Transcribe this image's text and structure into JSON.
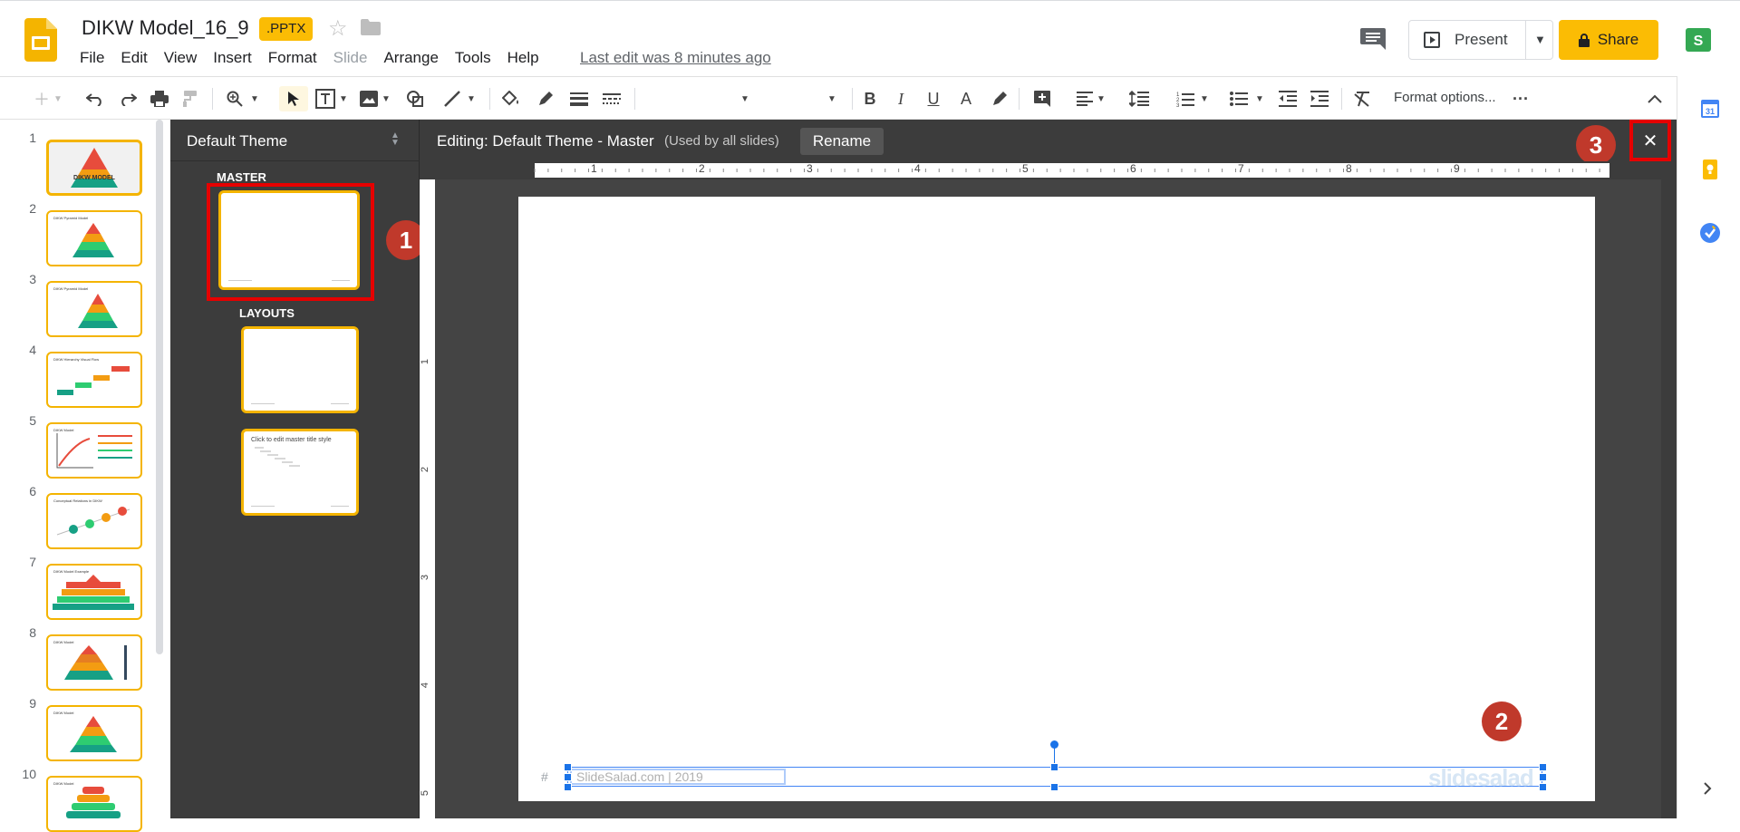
{
  "header": {
    "title": "DIKW Model_16_9",
    "badge": ".PPTX",
    "last_edit": "Last edit was 8 minutes ago",
    "present_label": "Present",
    "share_label": "Share"
  },
  "menu": [
    "File",
    "Edit",
    "View",
    "Insert",
    "Format",
    "Slide",
    "Arrange",
    "Tools",
    "Help"
  ],
  "toolbar": {
    "format_options": "Format options...",
    "more": "···"
  },
  "slides": {
    "numbers": [
      "1",
      "2",
      "3",
      "4",
      "5",
      "6",
      "7",
      "8",
      "9",
      "10"
    ],
    "thumb_texts": [
      "DIKW MODEL",
      "DIKW Pyramid Model",
      "DIKW Pyramid Model",
      "DIKW Hierarchy Visual Flow",
      "DIKW Model",
      "Conceptual Relations in DIKW",
      "DIKW Model Example",
      "DIKW Model",
      "DIKW Model",
      "DIKW Model"
    ]
  },
  "theme": {
    "name": "Default Theme",
    "master_label": "MASTER",
    "layouts_label": "LAYOUTS",
    "layout_title_text": "Click to edit master title style"
  },
  "editor": {
    "editing_title": "Editing: Default Theme - Master",
    "used_by": "(Used by all slides)",
    "rename_label": "Rename",
    "close_label": "✕",
    "ruler_h": [
      "1",
      "2",
      "3",
      "4",
      "5",
      "6",
      "7",
      "8",
      "9"
    ],
    "ruler_v": [
      "1",
      "2",
      "3",
      "4",
      "5"
    ],
    "footer_text": "SlideSalad.com | 2019",
    "slide_num_placeholder": "#",
    "watermark": "slidesalad"
  },
  "annotations": {
    "badge_1": "1",
    "badge_2": "2",
    "badge_3": "3"
  },
  "colors": {
    "accent": "#fbbc04",
    "highlight": "#e60000",
    "badge": "#c0392b",
    "selection": "#1a73e8"
  }
}
